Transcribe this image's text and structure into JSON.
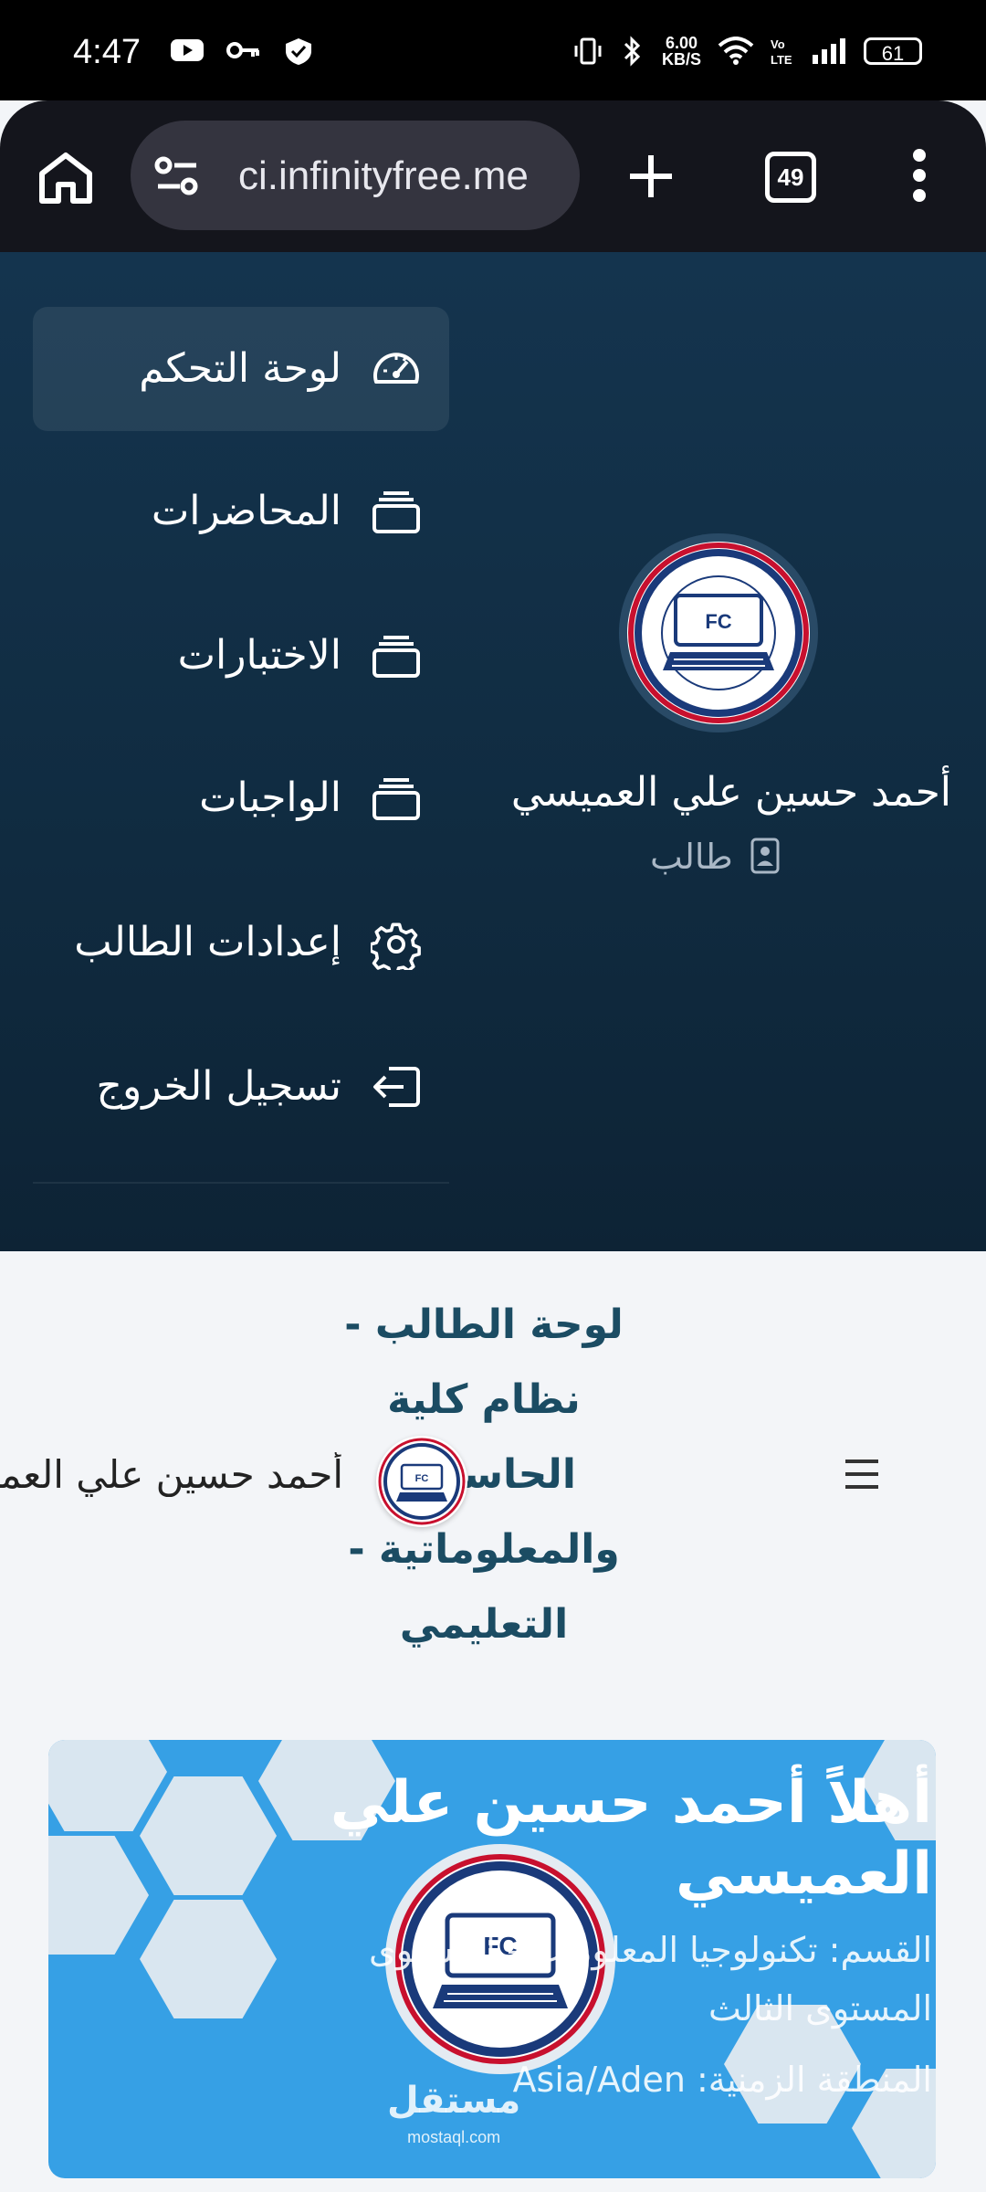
{
  "status_bar": {
    "time": "4:47",
    "network_speed_value": "6.00",
    "network_speed_unit": "KB/S",
    "battery": "61",
    "icons": [
      "youtube-icon",
      "key-icon",
      "vpn-icon",
      "vibrate-icon",
      "bluetooth-icon",
      "wifi-icon",
      "volte-icon",
      "signal-icon"
    ]
  },
  "browser": {
    "url": "ci.infinityfree.me",
    "tab_count": "49"
  },
  "sidebar": {
    "items": [
      {
        "label": "لوحة التحكم",
        "icon": "dashboard-gauge-icon",
        "active": true
      },
      {
        "label": "المحاضرات",
        "icon": "stack-icon",
        "active": false
      },
      {
        "label": "الاختبارات",
        "icon": "stack-icon",
        "active": false
      },
      {
        "label": "الواجبات",
        "icon": "stack-icon",
        "active": false
      },
      {
        "label": "إعدادات الطالب",
        "icon": "gear-icon",
        "active": false
      },
      {
        "label": "تسجيل الخروج",
        "icon": "logout-icon",
        "active": false
      }
    ],
    "profile": {
      "name": "أحمد حسين علي العميسي",
      "role": "طالب"
    }
  },
  "header": {
    "title": "لوحة الطالب - نظام كلية الحاسبات والمعلوماتية - التعليمي",
    "username": "أحمد حسين علي العميسي"
  },
  "banner": {
    "title": "أهلاً أحمد حسين علي العميسي",
    "department_line": "القسم: تكنولوجيا المعلومات - المستوى",
    "level_line": "المستوى الثالث",
    "timezone_line": "المنطقة الزمنية: Asia/Aden"
  },
  "watermark": {
    "arabic": "مستقل",
    "latin": "mostaql.com"
  },
  "colors": {
    "sidebar_bg": "#14344e",
    "banner_bg": "#36a0e5",
    "title_color": "#1b4c63"
  }
}
